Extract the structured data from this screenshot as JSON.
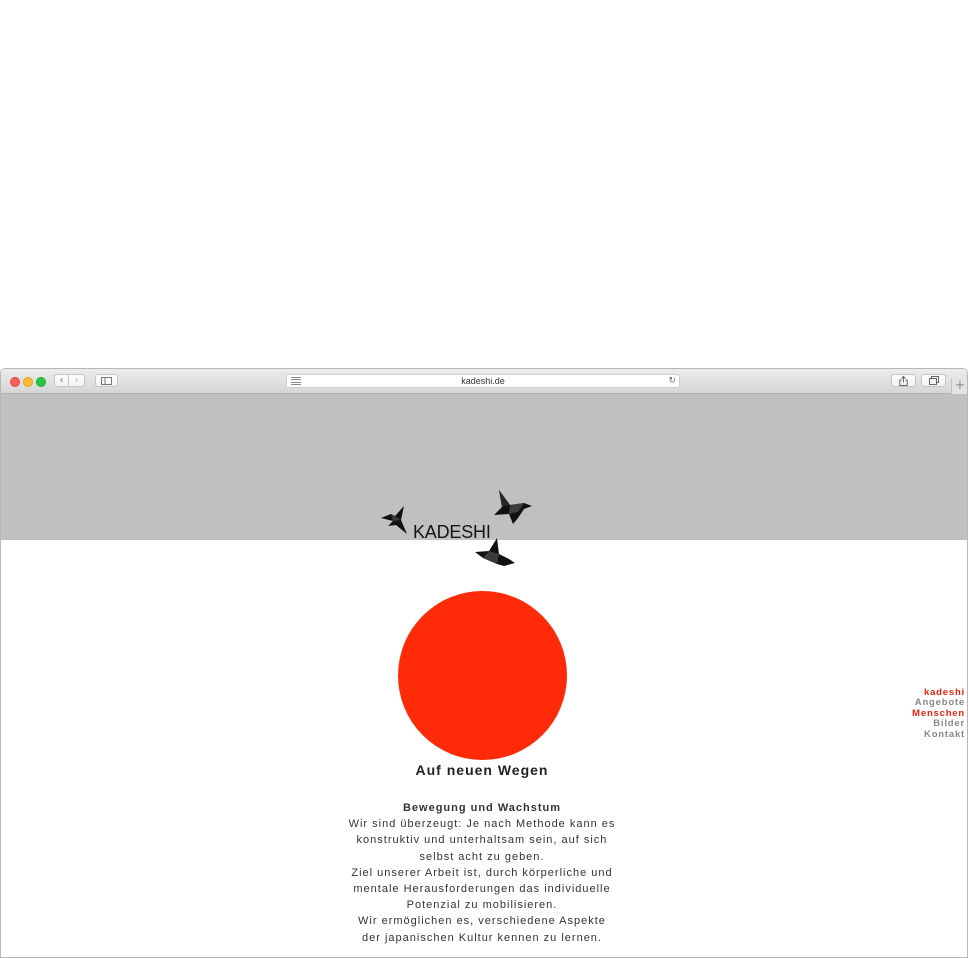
{
  "browser": {
    "url": "kadeshi.de"
  },
  "site": {
    "logo_text": "KADESHI",
    "headline": "Auf neuen Wegen",
    "subheading": "Bewegung und Wachstum",
    "paragraph_lines": [
      "Wir sind überzeugt: Je nach Methode kann es",
      "konstruktiv und unterhaltsam sein, auf sich",
      "selbst acht zu geben.",
      "Ziel unserer Arbeit ist, durch körperliche und",
      "mentale Herausforderungen das individuelle",
      "Potenzial zu mobilisieren.",
      "Wir ermöglichen es, verschiedene Aspekte",
      "der japanischen Kultur kennen zu lernen."
    ],
    "nav": [
      "kadeshi",
      "Angebote",
      "Menschen",
      "Bilder",
      "Kontakt"
    ],
    "nav_active": "Menschen"
  },
  "colors": {
    "sun": "#ff2a08",
    "header_band": "#c0c0c0",
    "accent": "#e8230b"
  }
}
